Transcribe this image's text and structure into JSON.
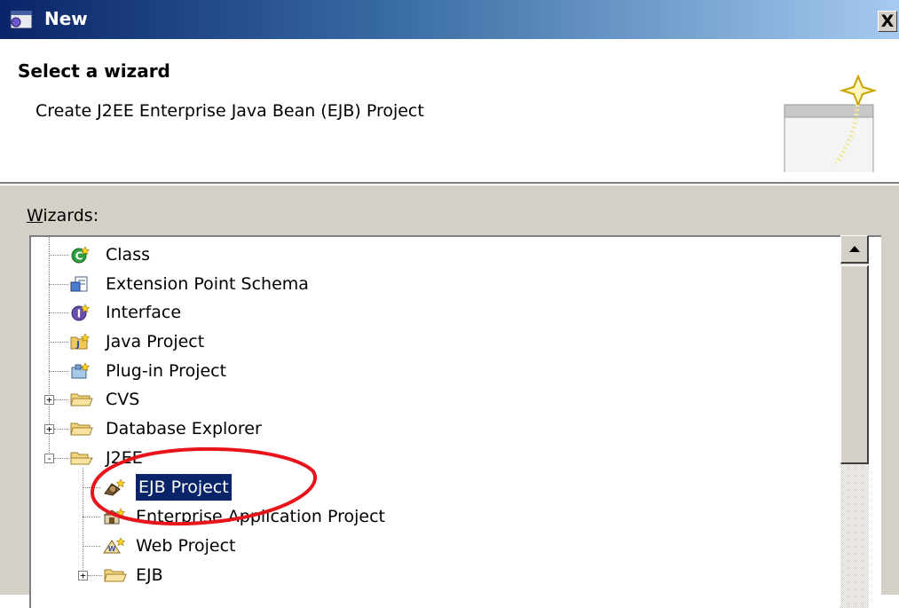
{
  "window": {
    "title": "New",
    "close_glyph": "X"
  },
  "header": {
    "title": "Select a wizard",
    "description": "Create J2EE Enterprise Java Bean (EJB) Project"
  },
  "wizards_label": {
    "mnemonic": "W",
    "rest": "izards:"
  },
  "tree": {
    "items": [
      {
        "label": "Class",
        "icon": "class-icon"
      },
      {
        "label": "Extension Point Schema",
        "icon": "schema-icon"
      },
      {
        "label": "Interface",
        "icon": "interface-icon"
      },
      {
        "label": "Java Project",
        "icon": "java-project-icon"
      },
      {
        "label": "Plug-in Project",
        "icon": "plugin-project-icon"
      },
      {
        "label": "CVS",
        "icon": "folder-icon",
        "expander": "+"
      },
      {
        "label": "Database Explorer",
        "icon": "folder-icon",
        "expander": "+"
      },
      {
        "label": "J2EE",
        "icon": "folder-open-icon",
        "expander": "-"
      },
      {
        "label": "EJB Project",
        "icon": "ejb-project-icon",
        "selected": true
      },
      {
        "label": "Enterprise Application Project",
        "icon": "enterprise-app-icon"
      },
      {
        "label": "Web Project",
        "icon": "web-project-icon"
      },
      {
        "label": "EJB",
        "icon": "folder-icon",
        "expander": "+"
      }
    ]
  },
  "colors": {
    "selection": "#0a246a",
    "annotation": "#e8141c",
    "titlebar_start": "#0a246a",
    "titlebar_end": "#a6caf0"
  }
}
